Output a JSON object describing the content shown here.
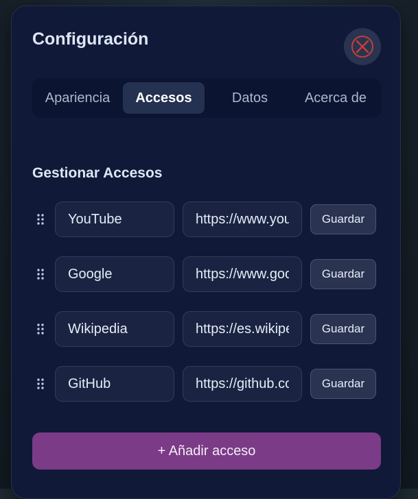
{
  "dialog": {
    "title": "Configuración",
    "close_icon": "close-icon",
    "close_icon_color": "#d9534f"
  },
  "tabs": [
    {
      "label": "Apariencia",
      "active": false
    },
    {
      "label": "Accesos",
      "active": true
    },
    {
      "label": "Datos",
      "active": false
    },
    {
      "label": "Acerca de",
      "active": false
    }
  ],
  "section": {
    "title": "Gestionar Accesos"
  },
  "shortcuts": [
    {
      "name": "YouTube",
      "url": "https://www.youtube.com",
      "save_label": "Guardar"
    },
    {
      "name": "Google",
      "url": "https://www.google.com",
      "save_label": "Guardar"
    },
    {
      "name": "Wikipedia",
      "url": "https://es.wikipedia.org",
      "save_label": "Guardar"
    },
    {
      "name": "GitHub",
      "url": "https://github.com",
      "save_label": "Guardar"
    }
  ],
  "add_button": {
    "label": "+ Añadir acceso"
  },
  "colors": {
    "panel_bg": "#101a38",
    "accent": "#7b3b87",
    "active_tab_bg": "#253150"
  }
}
